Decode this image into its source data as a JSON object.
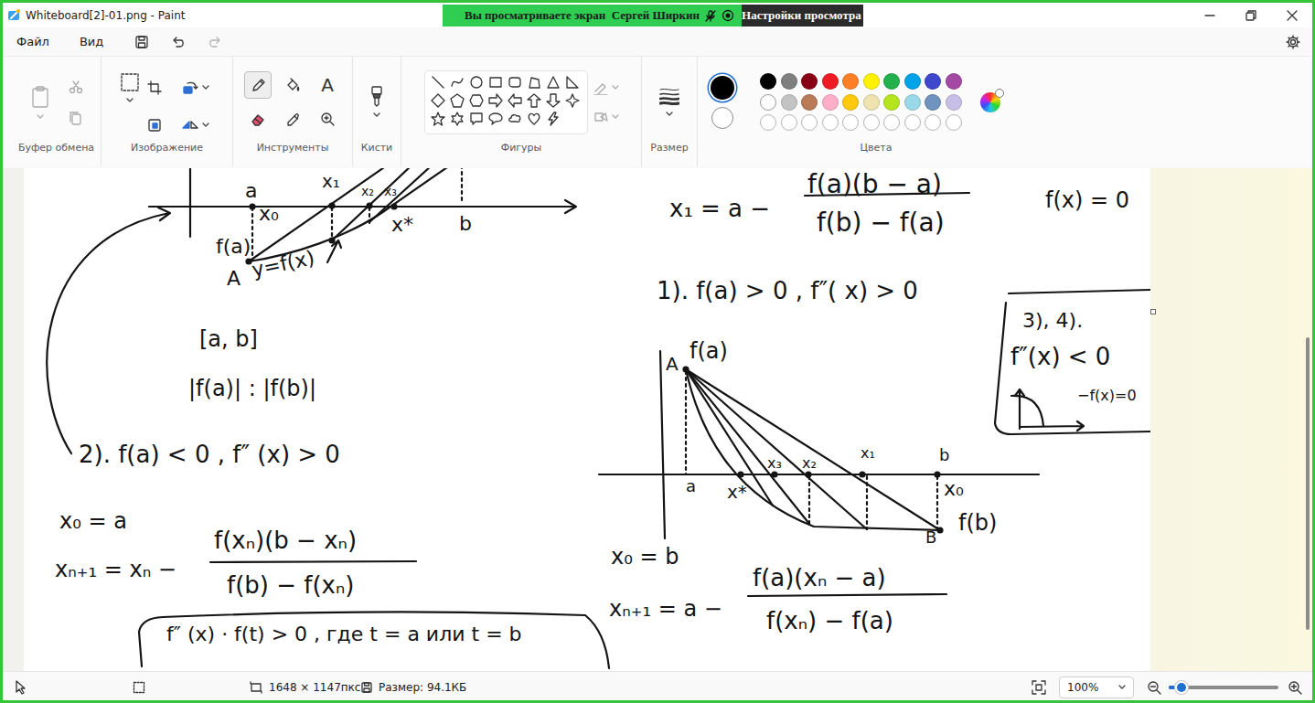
{
  "window": {
    "title": "Whiteboard[2]-01.png - Paint"
  },
  "screen_share": {
    "message": "Вы просматриваете экран  Сергей Ширкин",
    "button": "Настройки просмотра"
  },
  "menu": [
    {
      "label": "Файл"
    },
    {
      "label": "Вид"
    }
  ],
  "quick_actions": [
    {
      "kind": "save",
      "disabled": false
    },
    {
      "kind": "undo",
      "disabled": false
    },
    {
      "kind": "redo",
      "disabled": true
    }
  ],
  "ribbon": {
    "groups": [
      {
        "label": "Буфер обмена",
        "kind": "clipboard"
      },
      {
        "label": "Изображение",
        "kind": "image"
      },
      {
        "label": "Инструменты",
        "kind": "tools"
      },
      {
        "label": "Кисти",
        "kind": "brushes"
      },
      {
        "label": "Фигуры",
        "kind": "shapes"
      },
      {
        "label": "Размер",
        "kind": "size"
      },
      {
        "label": "Цвета",
        "kind": "colors"
      }
    ]
  },
  "tools": [
    {
      "kind": "pencil",
      "selected": true
    },
    {
      "kind": "fill",
      "selected": false
    },
    {
      "kind": "text",
      "selected": false,
      "glyph": "A"
    },
    {
      "kind": "eraser",
      "selected": false
    },
    {
      "kind": "picker",
      "selected": false
    },
    {
      "kind": "zoom",
      "selected": false
    }
  ],
  "colors": {
    "primary": {
      "color": "#000000",
      "selected": true
    },
    "secondary": {
      "color": "#ffffff",
      "selected": false
    },
    "palette": [
      {
        "color": "#000000",
        "empty": false
      },
      {
        "color": "#7f7f7f",
        "empty": false
      },
      {
        "color": "#880015",
        "empty": false
      },
      {
        "color": "#ed1c24",
        "empty": false
      },
      {
        "color": "#ff7f27",
        "empty": false
      },
      {
        "color": "#fff200",
        "empty": false
      },
      {
        "color": "#22b14c",
        "empty": false
      },
      {
        "color": "#00a2e8",
        "empty": false
      },
      {
        "color": "#3f48cc",
        "empty": false
      },
      {
        "color": "#a349a4",
        "empty": false
      },
      {
        "color": "#ffffff",
        "empty": false
      },
      {
        "color": "#c3c3c3",
        "empty": false
      },
      {
        "color": "#b97a57",
        "empty": false
      },
      {
        "color": "#ffaec9",
        "empty": false
      },
      {
        "color": "#ffc90e",
        "empty": false
      },
      {
        "color": "#efe4b0",
        "empty": false
      },
      {
        "color": "#b5e61d",
        "empty": false
      },
      {
        "color": "#99d9ea",
        "empty": false
      },
      {
        "color": "#7092be",
        "empty": false
      },
      {
        "color": "#c8bfe7",
        "empty": false
      },
      {
        "color": "#ffffff",
        "empty": true
      },
      {
        "color": "#ffffff",
        "empty": true
      },
      {
        "color": "#ffffff",
        "empty": true
      },
      {
        "color": "#ffffff",
        "empty": true
      },
      {
        "color": "#ffffff",
        "empty": true
      },
      {
        "color": "#ffffff",
        "empty": true
      },
      {
        "color": "#ffffff",
        "empty": true
      },
      {
        "color": "#ffffff",
        "empty": true
      },
      {
        "color": "#ffffff",
        "empty": true
      },
      {
        "color": "#ffffff",
        "empty": true
      }
    ]
  },
  "canvas": {
    "texts": [
      "a",
      "x₀",
      "x₁",
      "x₂",
      "x₃",
      "x*",
      "b",
      "f(a)",
      "A",
      "y=f(x)",
      "[a, b]",
      "|f(a)| : |f(b)|",
      "2). f(a) < 0 ,  f″ (x) > 0",
      "x₀ = a",
      "xₙ₊₁ = xₙ −",
      "f(xₙ)(b − xₙ)",
      "f(b) − f(xₙ)",
      "f″ (x) · f(t) > 0 ,  где t = a или t = b",
      "x₁ = a −",
      "f(a)(b − a)",
      "f(b) − f(a)",
      "f(x) = 0",
      "1). f(a) > 0 , f″( x) > 0",
      "3), 4).",
      "f″(x) < 0",
      "−f(x)=0",
      "A",
      "f(a)",
      "b",
      "x₁",
      "x₂",
      "x₃",
      "a",
      "x*",
      "x₀",
      "f(b)",
      "B",
      "x₀ = b",
      "xₙ₊₁ = a −",
      "f(a)(xₙ − a)",
      "f(xₙ) − f(a)"
    ]
  },
  "status_bar": {
    "dimensions": "1648 × 1147пкс",
    "file_size": "Размер: 94.1КБ",
    "zoom": "100%",
    "zoom_level": 0.12
  }
}
